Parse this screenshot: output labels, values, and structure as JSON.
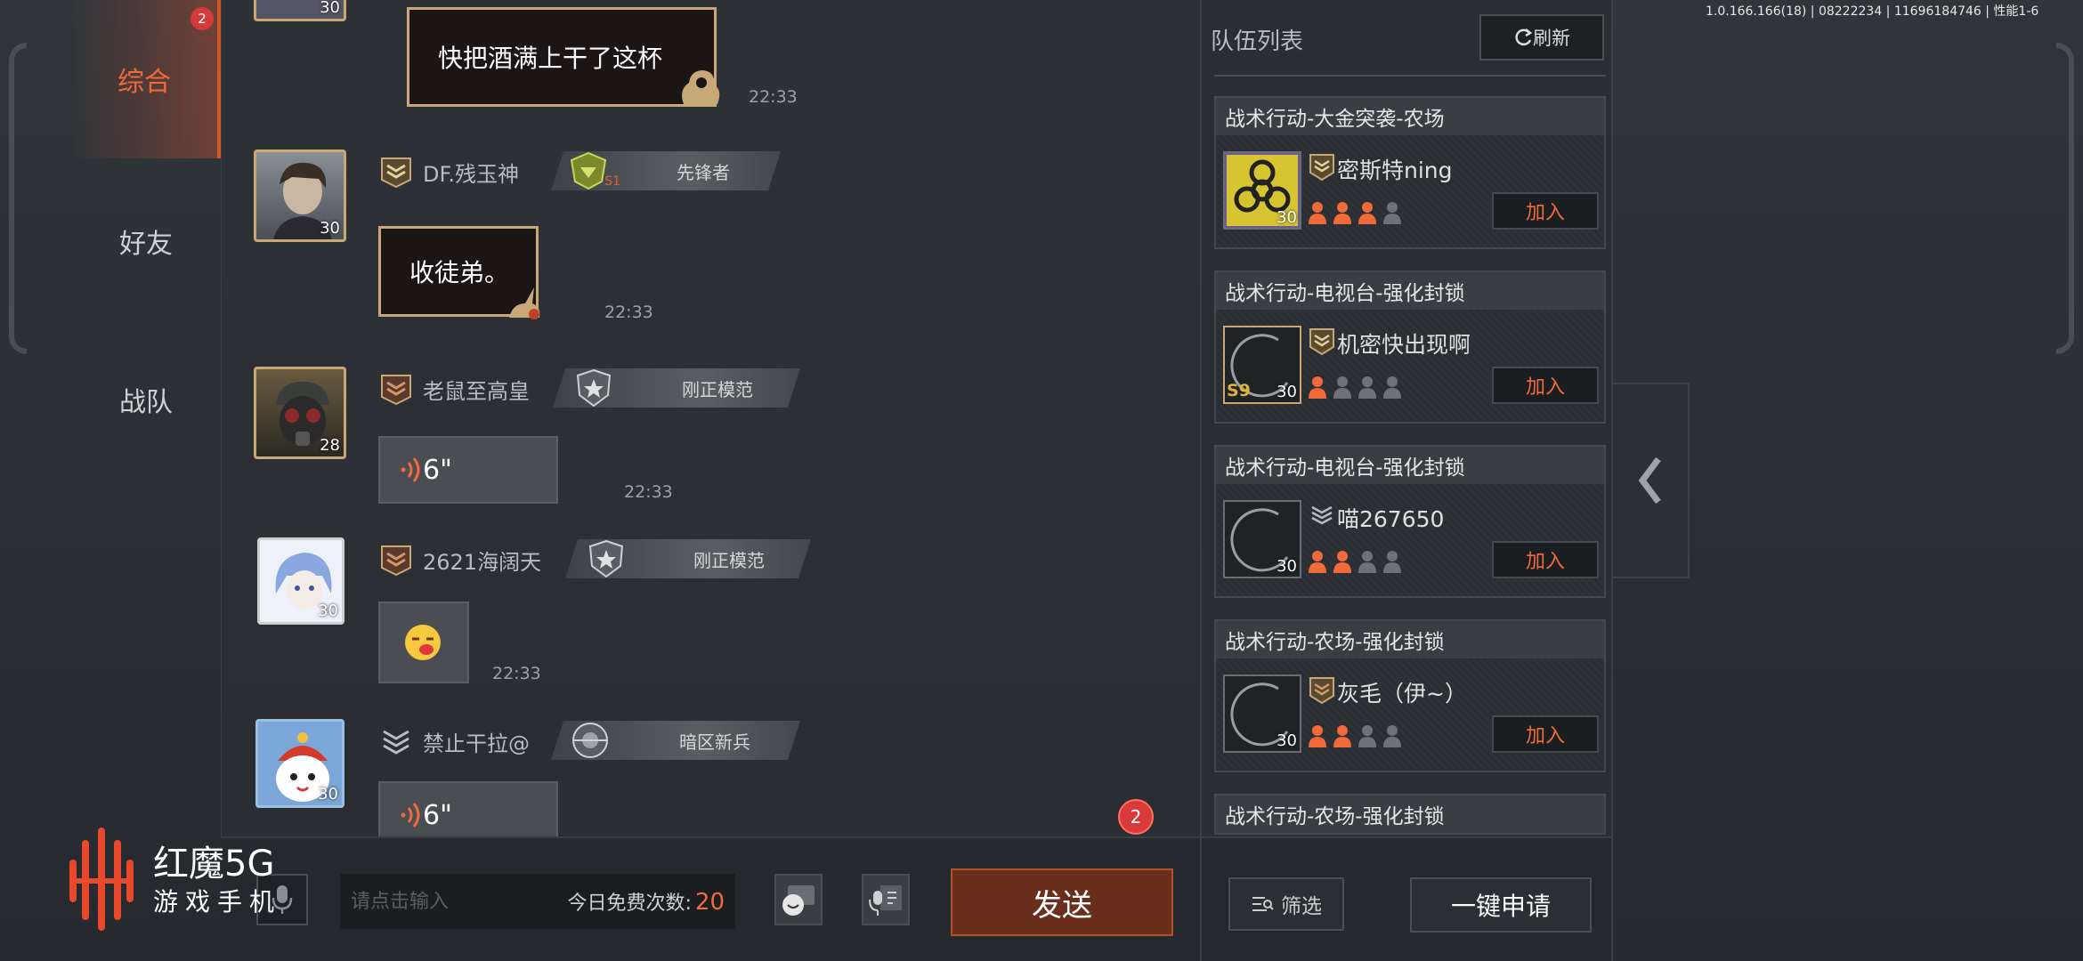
{
  "version": "1.0.166.166(18) | 08222234 | 11696184746 | 性能1-6",
  "tabs": [
    {
      "label": "综合",
      "badge": "2",
      "active": true
    },
    {
      "label": "好友"
    },
    {
      "label": "战队"
    }
  ],
  "messages": [
    {
      "level": "30",
      "text": "快把酒满上干了这杯",
      "time": "22:33"
    },
    {
      "level": "30",
      "name": "DF.残玉神",
      "season": "S1",
      "badge": "先锋者",
      "text": "收徒弟。",
      "time": "22:33"
    },
    {
      "level": "28",
      "name": "老鼠至高皇",
      "badge": "刚正模范",
      "voice": "6\"",
      "time": "22:33"
    },
    {
      "level": "30",
      "name": "2621海阔天",
      "badge": "刚正模范",
      "time": "22:33"
    },
    {
      "level": "30",
      "name": "禁止干拉@",
      "badge": "暗区新兵",
      "voice": "6\""
    }
  ],
  "input": {
    "placeholder": "请点击输入",
    "free_label": "今日免费次数:",
    "free_count": "20",
    "send": "发送",
    "unread": "2"
  },
  "logo": {
    "line1": "红魔5G",
    "line2": "游戏手机"
  },
  "teams": {
    "title": "队伍列表",
    "refresh": "刷新",
    "join_label": "加入",
    "cards": [
      {
        "title": "战术行动-大金突袭-农场",
        "name": "密斯特ning",
        "level": "30",
        "filled": 3
      },
      {
        "title": "战术行动-电视台-强化封锁",
        "name": "机密快出现啊",
        "level": "30",
        "season": "S9",
        "filled": 1
      },
      {
        "title": "战术行动-电视台-强化封锁",
        "name": "喵267650",
        "level": "30",
        "filled": 2
      },
      {
        "title": "战术行动-农场-强化封锁",
        "name": "灰毛（伊~）",
        "level": "30",
        "filled": 2
      },
      {
        "title": "战术行动-农场-强化封锁"
      }
    ],
    "filter": "筛选",
    "apply_all": "一键申请"
  },
  "colors": {
    "accent": "#f06a3a",
    "send_bg": "#6a2f1c",
    "badge_red": "#d93a3a",
    "slot_empty": "#6e7276"
  }
}
